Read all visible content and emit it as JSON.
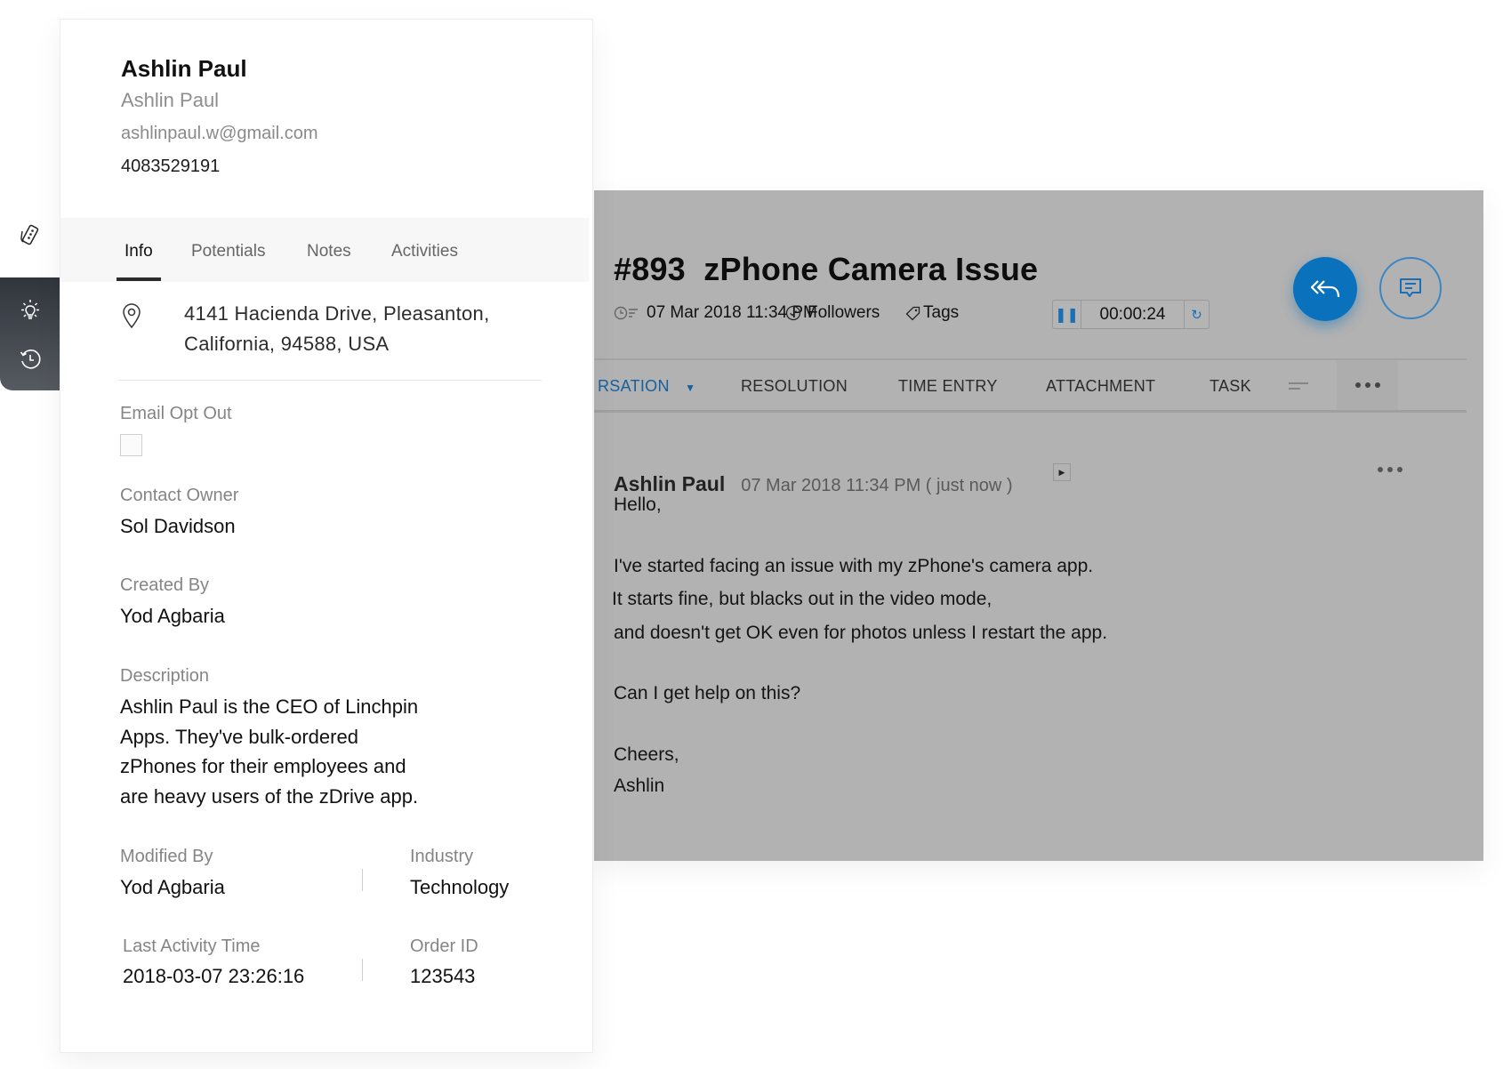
{
  "contact": {
    "name": "Ashlin Paul",
    "display_name": "Ashlin Paul",
    "email": "ashlinpaul.w@gmail.com",
    "phone": "4083529191",
    "tabs": [
      {
        "label": "Info",
        "active": true
      },
      {
        "label": "Potentials",
        "active": false
      },
      {
        "label": "Notes",
        "active": false
      },
      {
        "label": "Activities",
        "active": false
      }
    ],
    "address": {
      "icon": "location-pin-icon",
      "line1": "4141 Hacienda Drive, Pleasanton,",
      "line2": "California, 94588, USA"
    },
    "fields": {
      "email_opt_out": {
        "label": "Email Opt Out",
        "checked": false
      },
      "contact_owner": {
        "label": "Contact Owner",
        "value": "Sol Davidson"
      },
      "created_by": {
        "label": "Created By",
        "value": "Yod Agbaria"
      },
      "description": {
        "label": "Description",
        "lines": [
          "Ashlin Paul is the CEO of Linchpin",
          "Apps. They've bulk-ordered",
          "zPhones for their employees and",
          "are heavy users of the zDrive app."
        ]
      },
      "modified_by": {
        "label": "Modified By",
        "value": "Yod Agbaria"
      },
      "industry": {
        "label": "Industry",
        "value": "Technology"
      },
      "last_activity_time": {
        "label": "Last Activity Time",
        "value": "2018-03-07 23:26:16"
      },
      "order_id": {
        "label": "Order ID",
        "value": "123543"
      }
    }
  },
  "rail": {
    "items": [
      {
        "icon": "tickets-icon",
        "active": true
      },
      {
        "icon": "lightbulb-icon",
        "active": false
      },
      {
        "icon": "history-icon",
        "active": false
      }
    ]
  },
  "ticket": {
    "number": "#893",
    "subject": "zPhone Camera Issue",
    "created": "07 Mar 2018 11:34 PM",
    "followers_label": "Followers",
    "tags_label": "Tags",
    "timer": "00:00:24",
    "tabs": [
      {
        "label": "RSATION",
        "active": true
      },
      {
        "label": "RESOLUTION",
        "active": false
      },
      {
        "label": "TIME ENTRY",
        "active": false
      },
      {
        "label": "ATTACHMENT",
        "active": false
      },
      {
        "label": "TASK",
        "active": false
      }
    ],
    "accent": "#0a72bd",
    "overlay_gray": "#b2b2b2",
    "message": {
      "author": "Ashlin Paul",
      "time": "07 Mar 2018 11:34 PM ( just now )",
      "body": [
        "Hello,",
        "I've started facing an issue with my zPhone's camera app.",
        "It starts fine, but blacks out in the video mode,",
        "and doesn't get OK even for photos unless I restart the app.",
        "Can I get help on this?",
        "Cheers,",
        "Ashlin"
      ]
    }
  }
}
